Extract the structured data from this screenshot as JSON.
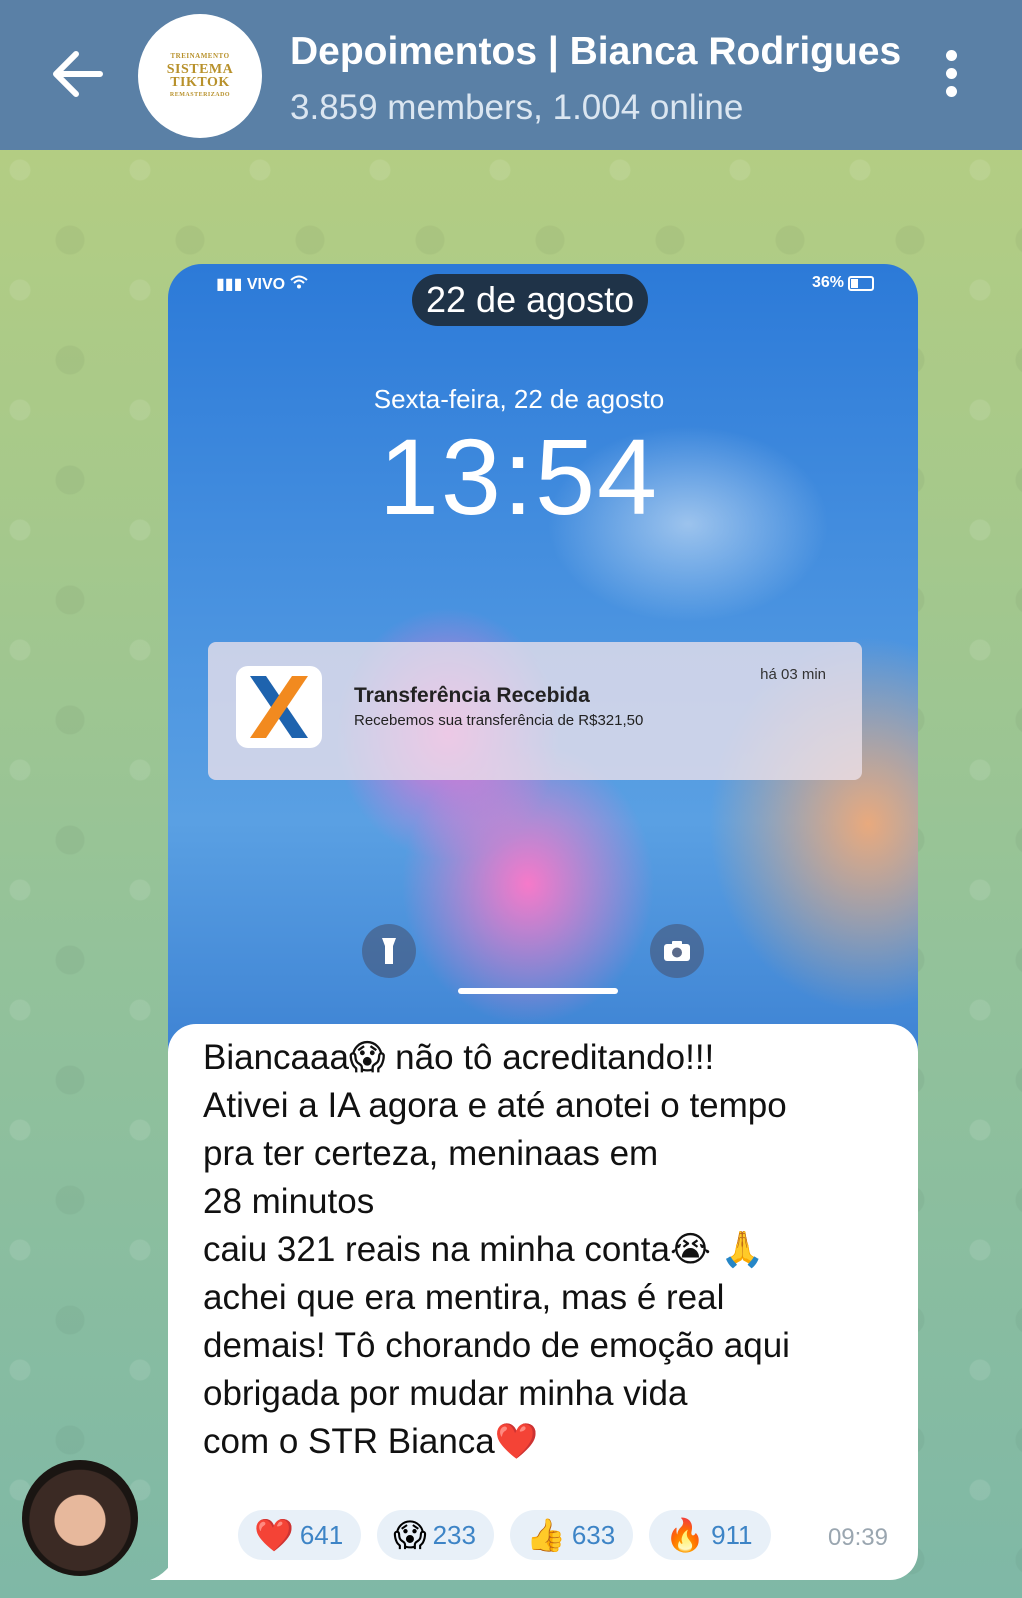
{
  "header": {
    "title": "Depoimentos | Bianca Rodrigues",
    "subtitle": "3.859 members, 1.004 online",
    "logo_lines": [
      "TREINAMENTO",
      "SISTEMA TIKTOK",
      "REMASTERIZADO"
    ]
  },
  "phone": {
    "carrier": "VIVO",
    "battery": "36%",
    "date_pill": "22 de agosto",
    "lock_date": "Sexta-feira, 22 de agosto",
    "lock_time": "13:54",
    "notification": {
      "title": "Transferência Recebida",
      "body": "Recebemos sua transferência de R$321,50",
      "time": "há 03 min"
    }
  },
  "message": {
    "text": "Biancaaa😱 não tô acreditando!!!\nAtivei a IA agora e até anotei o tempo\npra ter certeza, meninaas em\n28 minutos\ncaiu 321 reais na minha conta😭 🙏\nachei que era mentira, mas é real\ndemais! Tô chorando de emoção aqui\nobrigada por mudar minha vida\ncom o STR Bianca❤️",
    "time": "09:39",
    "reactions": [
      {
        "emoji": "❤️",
        "count": "641"
      },
      {
        "emoji": "😱",
        "count": "233"
      },
      {
        "emoji": "👍",
        "count": "633"
      },
      {
        "emoji": "🔥",
        "count": "911"
      }
    ]
  },
  "colors": {
    "header_bg": "#5a80a6",
    "reaction_bg": "#e8f0f8",
    "reaction_count": "#3d84c6"
  }
}
